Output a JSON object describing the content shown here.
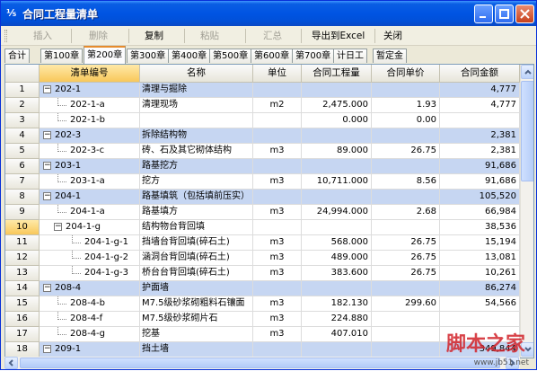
{
  "window": {
    "title": "合同工程量清单"
  },
  "toolbar": {
    "insert": "插入",
    "delete": "删除",
    "copy": "复制",
    "paste": "粘贴",
    "summary": "汇总",
    "export": "导出到Excel",
    "close": "关闭"
  },
  "tabs": [
    "合计",
    "第100章",
    "第200章",
    "第300章",
    "第400章",
    "第500章",
    "第600章",
    "第700章",
    "计日工",
    "暂定金"
  ],
  "active_tab": "第200章",
  "columns": {
    "code": "清单编号",
    "name": "名称",
    "unit": "单位",
    "qty": "合同工程量",
    "price": "合同单价",
    "amount": "合同金额"
  },
  "rows": [
    {
      "n": "1",
      "code": "202-1",
      "name": "清理与掘除",
      "unit": "",
      "qty": "",
      "price": "",
      "amount": "4,777",
      "group": true,
      "level": 0,
      "exp": "−"
    },
    {
      "n": "2",
      "code": "202-1-a",
      "name": "清理现场",
      "unit": "m2",
      "qty": "2,475.000",
      "price": "1.93",
      "amount": "4,777",
      "level": 1
    },
    {
      "n": "3",
      "code": "202-1-b",
      "name": "",
      "unit": "",
      "qty": "0.000",
      "price": "0.00",
      "amount": "",
      "level": 1
    },
    {
      "n": "4",
      "code": "202-3",
      "name": "拆除结构物",
      "unit": "",
      "qty": "",
      "price": "",
      "amount": "2,381",
      "group": true,
      "level": 0,
      "exp": "−"
    },
    {
      "n": "5",
      "code": "202-3-c",
      "name": "砖、石及其它砌体结构",
      "unit": "m3",
      "qty": "89.000",
      "price": "26.75",
      "amount": "2,381",
      "level": 1
    },
    {
      "n": "6",
      "code": "203-1",
      "name": "路基挖方",
      "unit": "",
      "qty": "",
      "price": "",
      "amount": "91,686",
      "group": true,
      "level": 0,
      "exp": "−"
    },
    {
      "n": "7",
      "code": "203-1-a",
      "name": "挖方",
      "unit": "m3",
      "qty": "10,711.000",
      "price": "8.56",
      "amount": "91,686",
      "level": 1
    },
    {
      "n": "8",
      "code": "204-1",
      "name": "路基填筑（包括填前压实）",
      "unit": "",
      "qty": "",
      "price": "",
      "amount": "105,520",
      "group": true,
      "level": 0,
      "exp": "−"
    },
    {
      "n": "9",
      "code": "204-1-a",
      "name": "路基填方",
      "unit": "m3",
      "qty": "24,994.000",
      "price": "2.68",
      "amount": "66,984",
      "level": 1
    },
    {
      "n": "10",
      "code": "204-1-g",
      "name": "结构物台背回填",
      "unit": "",
      "qty": "",
      "price": "",
      "amount": "38,536",
      "level": 1,
      "exp": "−",
      "selected": true
    },
    {
      "n": "11",
      "code": "204-1-g-1",
      "name": "挡墙台背回填(碎石土)",
      "unit": "m3",
      "qty": "568.000",
      "price": "26.75",
      "amount": "15,194",
      "level": 2
    },
    {
      "n": "12",
      "code": "204-1-g-2",
      "name": "涵洞台背回填(碎石土)",
      "unit": "m3",
      "qty": "489.000",
      "price": "26.75",
      "amount": "13,081",
      "level": 2
    },
    {
      "n": "13",
      "code": "204-1-g-3",
      "name": "桥台台背回填(碎石土)",
      "unit": "m3",
      "qty": "383.600",
      "price": "26.75",
      "amount": "10,261",
      "level": 2
    },
    {
      "n": "14",
      "code": "208-4",
      "name": "护面墙",
      "unit": "",
      "qty": "",
      "price": "",
      "amount": "86,274",
      "group": true,
      "level": 0,
      "exp": "−"
    },
    {
      "n": "15",
      "code": "208-4-b",
      "name": "M7.5级砂浆砌粗料石镶面",
      "unit": "m3",
      "qty": "182.130",
      "price": "299.60",
      "amount": "54,566",
      "level": 1
    },
    {
      "n": "16",
      "code": "208-4-f",
      "name": "M7.5级砂浆砌片石",
      "unit": "m3",
      "qty": "224.880",
      "price": "",
      "amount": "",
      "level": 1
    },
    {
      "n": "17",
      "code": "208-4-g",
      "name": "挖基",
      "unit": "m3",
      "qty": "407.010",
      "price": "",
      "amount": "",
      "level": 1
    },
    {
      "n": "18",
      "code": "209-1",
      "name": "挡土墙",
      "unit": "",
      "qty": "",
      "price": "",
      "amount": "349,844",
      "group": true,
      "level": 0,
      "exp": "−"
    }
  ],
  "watermark": {
    "text": "脚本之家",
    "url": "www.jb51.net"
  }
}
